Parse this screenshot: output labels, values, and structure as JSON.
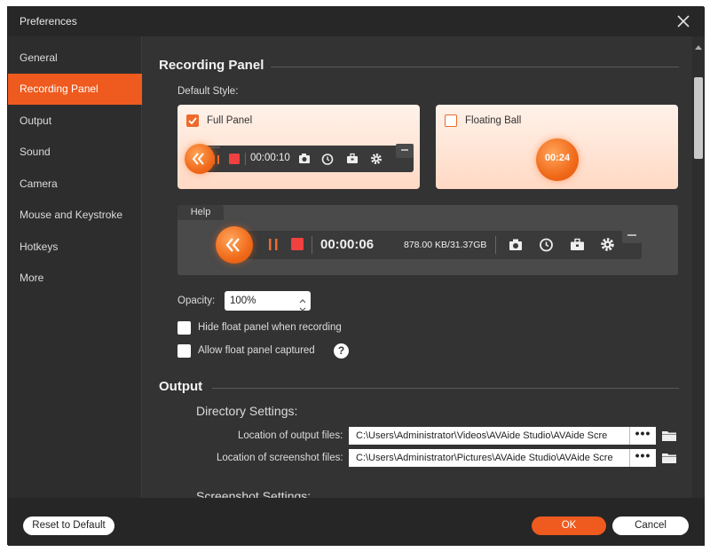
{
  "window": {
    "title": "Preferences"
  },
  "sidebar": {
    "items": [
      {
        "label": "General"
      },
      {
        "label": "Recording Panel"
      },
      {
        "label": "Output"
      },
      {
        "label": "Sound"
      },
      {
        "label": "Camera"
      },
      {
        "label": "Mouse and Keystroke"
      },
      {
        "label": "Hotkeys"
      },
      {
        "label": "More"
      }
    ],
    "active": "Recording Panel"
  },
  "recording_panel": {
    "title": "Recording Panel",
    "default_style_label": "Default Style:",
    "full_panel": {
      "label": "Full Panel",
      "checked": true,
      "time": "00:00:10"
    },
    "floating_ball": {
      "label": "Floating Ball",
      "checked": false,
      "time": "00:24"
    },
    "help": {
      "tab_label": "Help",
      "time": "00:00:06",
      "size": "878.00 KB/31.37GB"
    },
    "opacity": {
      "label": "Opacity:",
      "value": "100%"
    },
    "hide_float_panel": {
      "label": "Hide float panel when recording",
      "checked": false
    },
    "allow_float_captured": {
      "label": "Allow float panel captured",
      "checked": false
    },
    "help_icon": "?"
  },
  "output": {
    "title": "Output",
    "directory_settings_label": "Directory Settings:",
    "output_files": {
      "label": "Location of output files:",
      "value": "C:\\Users\\Administrator\\Videos\\AVAide Studio\\AVAide Scre"
    },
    "screenshot_files": {
      "label": "Location of screenshot files:",
      "value": "C:\\Users\\Administrator\\Pictures\\AVAide Studio\\AVAide Scre"
    },
    "dots": "•••",
    "screenshot_settings_label": "Screenshot Settings:"
  },
  "footer": {
    "reset_label": "Reset to Default",
    "ok_label": "OK",
    "cancel_label": "Cancel"
  },
  "colors": {
    "accent": "#ef5a1e",
    "panel_bg": "#333333",
    "sidebar_bg": "#2d2d2d"
  }
}
